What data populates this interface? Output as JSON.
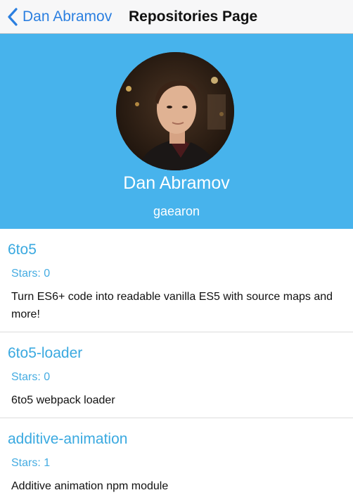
{
  "nav": {
    "back_label": "Dan Abramov",
    "title": "Repositories Page",
    "back_icon": "chevron-left-icon",
    "accent_color": "#2b7fe0"
  },
  "profile": {
    "name": "Dan Abramov",
    "login": "gaearon",
    "background_color": "#47b3ec"
  },
  "repos": [
    {
      "name": "6to5",
      "stars": "Stars: 0",
      "description": "Turn ES6+ code into readable vanilla ES5 with source maps and more!"
    },
    {
      "name": "6to5-loader",
      "stars": "Stars: 0",
      "description": "6to5 webpack loader"
    },
    {
      "name": "additive-animation",
      "stars": "Stars: 1",
      "description": "Additive animation npm module"
    }
  ]
}
